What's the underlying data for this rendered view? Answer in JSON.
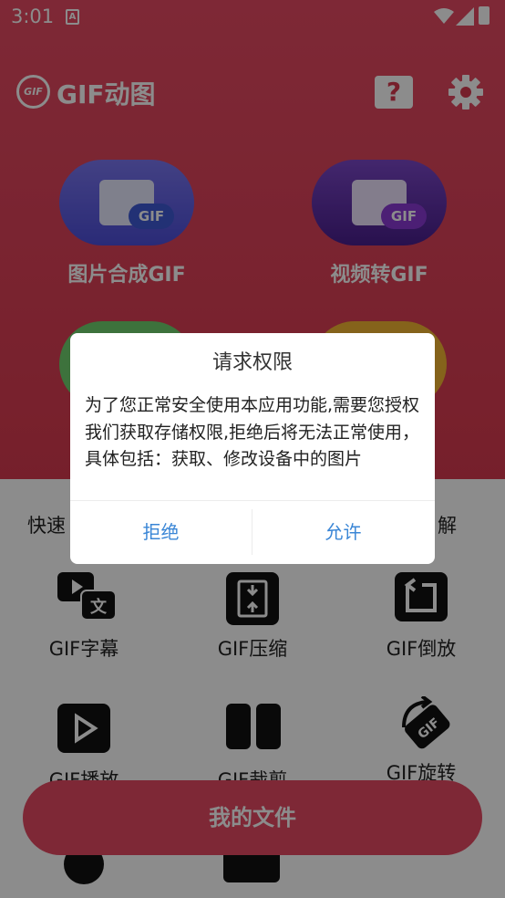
{
  "status_bar": {
    "time": "3:01",
    "notification_letter": "A"
  },
  "header": {
    "logo_text": "GIF",
    "title": "GIF动图"
  },
  "features": [
    {
      "label": "图片合成GIF",
      "tag": "GIF",
      "color": "#5a5ae0"
    },
    {
      "label": "视频转GIF",
      "tag": "GIF",
      "color": "#5b2aa8"
    }
  ],
  "tools": {
    "row1_left_partial": "快速",
    "row1_right_partial": "解",
    "subtitle": "GIF字幕",
    "compress": "GIF压缩",
    "reverse": "GIF倒放",
    "play": "GIF播放",
    "crop": "GIF裁剪",
    "rotate": "GIF旋转"
  },
  "my_files_button": "我的文件",
  "dialog": {
    "title": "请求权限",
    "message": "为了您正常安全使用本应用功能,需要您授权我们获取存储权限,拒绝后将无法正常使用，具体包括：获取、修改设备中的图片",
    "deny": "拒绝",
    "allow": "允许"
  },
  "colors": {
    "accent": "#e54a63",
    "dialog_button": "#3a86d6"
  }
}
